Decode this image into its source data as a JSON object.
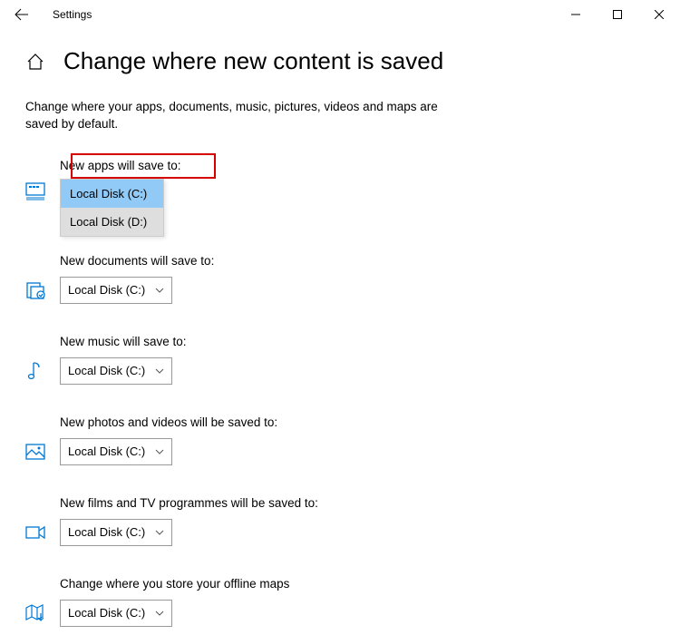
{
  "window": {
    "title": "Settings"
  },
  "page": {
    "heading": "Change where new content is saved",
    "description": "Change where your apps, documents, music, pictures, videos and maps are saved by default."
  },
  "dropdown_options": [
    "Local Disk (C:)",
    "Local Disk (D:)"
  ],
  "sections": {
    "apps": {
      "label": "New apps will save to:",
      "value": "Local Disk (C:)",
      "highlighted": true,
      "dropdown_open": true
    },
    "documents": {
      "label": "New documents will save to:",
      "value": "Local Disk (C:)"
    },
    "music": {
      "label": "New music will save to:",
      "value": "Local Disk (C:)"
    },
    "photos": {
      "label": "New photos and videos will be saved to:",
      "value": "Local Disk (C:)"
    },
    "films": {
      "label": "New films and TV programmes will be saved to:",
      "value": "Local Disk (C:)"
    },
    "maps": {
      "label": "Change where you store your offline maps",
      "value": "Local Disk (C:)"
    }
  }
}
